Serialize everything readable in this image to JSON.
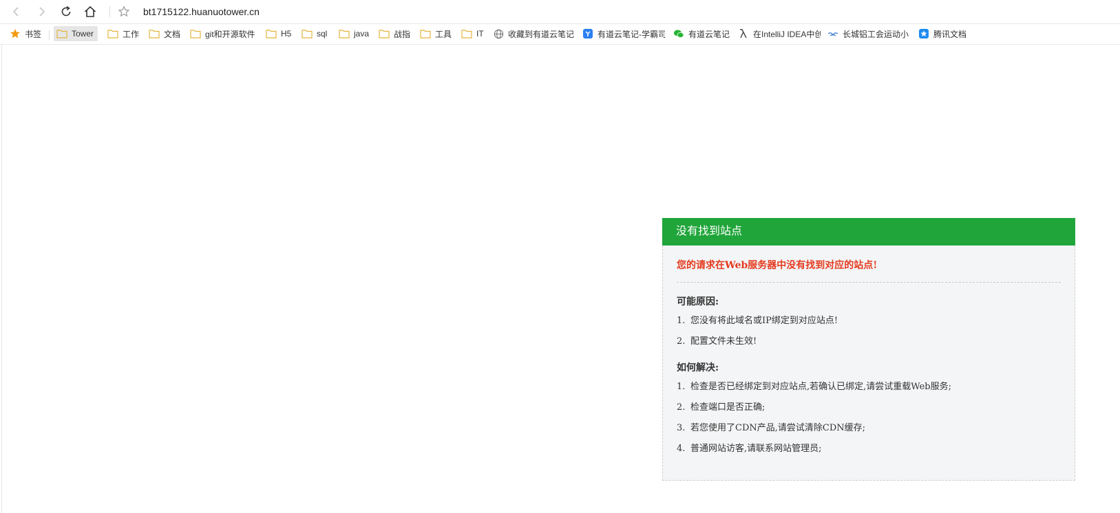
{
  "browser": {
    "url": "bt1715122.huanuotower.cn",
    "nav": {
      "back_icon": "chevron-left-icon",
      "forward_icon": "chevron-right-icon",
      "reload_icon": "reload-icon",
      "home_icon": "home-icon",
      "star_icon": "star-outline-icon"
    }
  },
  "bookmarks": [
    {
      "label": "书签",
      "icon": "star-icon"
    },
    {
      "label": "Tower",
      "icon": "folder-icon"
    },
    {
      "label": "工作",
      "icon": "folder-icon"
    },
    {
      "label": "文档",
      "icon": "folder-icon"
    },
    {
      "label": "git和开源软件",
      "icon": "folder-icon"
    },
    {
      "label": "H5",
      "icon": "folder-icon"
    },
    {
      "label": "sql",
      "icon": "folder-icon"
    },
    {
      "label": "java",
      "icon": "folder-icon"
    },
    {
      "label": "战指",
      "icon": "folder-icon"
    },
    {
      "label": "工具",
      "icon": "folder-icon"
    },
    {
      "label": "IT",
      "icon": "folder-icon"
    },
    {
      "label": "收藏到有道云笔记",
      "icon": "globe-icon"
    },
    {
      "label": "有道云笔记-学霸司",
      "icon": "youdao-icon"
    },
    {
      "label": "有道云笔记",
      "icon": "wechat-icon"
    },
    {
      "label": "在IntelliJ IDEA中创",
      "icon": "lambda-icon"
    },
    {
      "label": "长城铝工会运动小",
      "icon": "bird-icon"
    },
    {
      "label": "腾讯文档",
      "icon": "tencent-docs-icon"
    }
  ],
  "error": {
    "title": "没有找到站点",
    "message": "您的请求在Web服务器中没有找到对应的站点!",
    "reasons_title": "可能原因:",
    "reasons": [
      {
        "num": "1.",
        "text": "您没有将此域名或IP绑定到对应站点!"
      },
      {
        "num": "2.",
        "text": "配置文件未生效!"
      }
    ],
    "solutions_title": "如何解决:",
    "solutions": [
      {
        "num": "1.",
        "text": "检查是否已经绑定到对应站点,若确认已绑定,请尝试重载Web服务;"
      },
      {
        "num": "2.",
        "text": "检查端口是否正确;"
      },
      {
        "num": "3.",
        "text": "若您使用了CDN产品,请尝试清除CDN缓存;"
      },
      {
        "num": "4.",
        "text": "普通网站访客,请联系网站管理员;"
      }
    ]
  },
  "colors": {
    "header_green": "#20a53a",
    "error_red": "#e53a1e",
    "box_bg": "#f3f5f6",
    "folder_yellow": "#f5c84a",
    "star_orange": "#f39c12"
  }
}
